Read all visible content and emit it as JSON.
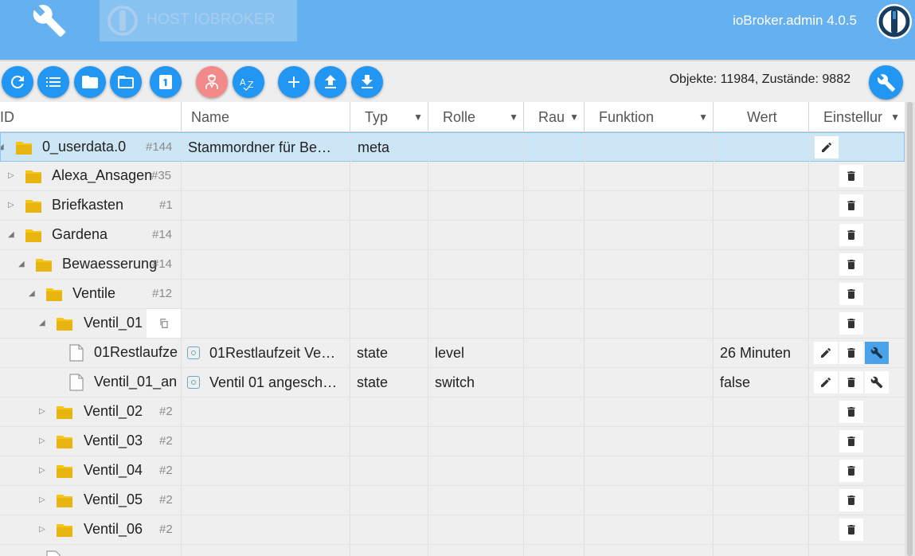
{
  "header": {
    "host_label": "HOST IOBROKER",
    "version": "ioBroker.admin 4.0.5"
  },
  "toolbar": {
    "buttons": [
      "refresh-icon",
      "list-icon",
      "folder-icon",
      "folder-open-icon",
      "one-icon",
      "expert-mode-icon",
      "sort-az-icon",
      "add-icon",
      "upload-icon",
      "download-icon"
    ],
    "counts": "Objekte: 11984, Zustände: 9882"
  },
  "table": {
    "columns": {
      "id": "ID",
      "name": "Name",
      "typ": "Typ",
      "rolle": "Rolle",
      "raum": "Rau",
      "funktion": "Funktion",
      "wert": "Wert",
      "einstellungen": "Einstellur"
    },
    "rows": [
      {
        "id": "0_userdata.0",
        "count": "#144",
        "name": "Stammordner für Be…",
        "typ": "meta",
        "rolle": "",
        "wert": ""
      },
      {
        "id": "Alexa_Ansagen",
        "count": "#35",
        "name": "",
        "typ": "",
        "rolle": "",
        "wert": ""
      },
      {
        "id": "Briefkasten",
        "count": "#1",
        "name": "",
        "typ": "",
        "rolle": "",
        "wert": ""
      },
      {
        "id": "Gardena",
        "count": "#14",
        "name": "",
        "typ": "",
        "rolle": "",
        "wert": ""
      },
      {
        "id": "Bewaesserung",
        "count": "#14",
        "name": "",
        "typ": "",
        "rolle": "",
        "wert": ""
      },
      {
        "id": "Ventile",
        "count": "#12",
        "name": "",
        "typ": "",
        "rolle": "",
        "wert": ""
      },
      {
        "id": "Ventil_01",
        "count": "",
        "name": "",
        "typ": "",
        "rolle": "",
        "wert": ""
      },
      {
        "id": "01Restlaufze",
        "count": "",
        "name": "01Restlaufzeit Ve…",
        "typ": "state",
        "rolle": "level",
        "wert": "26 Minuten"
      },
      {
        "id": "Ventil_01_an",
        "count": "",
        "name": "Ventil 01 angesch…",
        "typ": "state",
        "rolle": "switch",
        "wert": "false"
      },
      {
        "id": "Ventil_02",
        "count": "#2",
        "name": "",
        "typ": "",
        "rolle": "",
        "wert": ""
      },
      {
        "id": "Ventil_03",
        "count": "#2",
        "name": "",
        "typ": "",
        "rolle": "",
        "wert": ""
      },
      {
        "id": "Ventil_04",
        "count": "#2",
        "name": "",
        "typ": "",
        "rolle": "",
        "wert": ""
      },
      {
        "id": "Ventil_05",
        "count": "#2",
        "name": "",
        "typ": "",
        "rolle": "",
        "wert": ""
      },
      {
        "id": "Ventil_06",
        "count": "#2",
        "name": "",
        "typ": "",
        "rolle": "",
        "wert": ""
      }
    ]
  },
  "colors": {
    "appbar": "#64b0f0",
    "primary": "#2196f3",
    "expert": "#f38a8a",
    "selected_row": "#cde6f6"
  }
}
